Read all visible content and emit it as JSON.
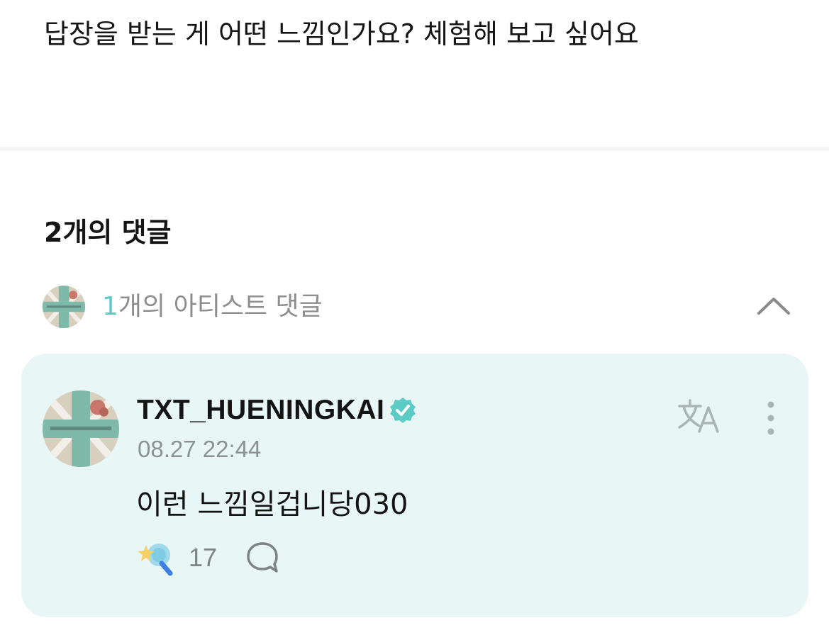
{
  "post": {
    "body": "답장을 받는 게 어떤 느낌인가요? 체험해 보고 싶어요"
  },
  "comments": {
    "count_label": "2개의 댓글",
    "artist_section": {
      "count": "1",
      "label": "개의 아티스트 댓글",
      "avatar_icon": "txt-logo-avatar",
      "toggle_icon": "chevron-up-icon"
    },
    "items": [
      {
        "author": "TXT_HUENINGKAI",
        "verified": true,
        "timestamp": "08.27 22:44",
        "text": "이런 느낌일겁니당030",
        "likes": "17",
        "translate_icon": "translate-icon",
        "more_icon": "more-vertical-icon",
        "reply_icon": "speech-bubble-icon"
      }
    ]
  },
  "colors": {
    "accent": "#5ccbc6",
    "card_background": "#e8f7f5",
    "muted_text": "#8d8d8d"
  }
}
